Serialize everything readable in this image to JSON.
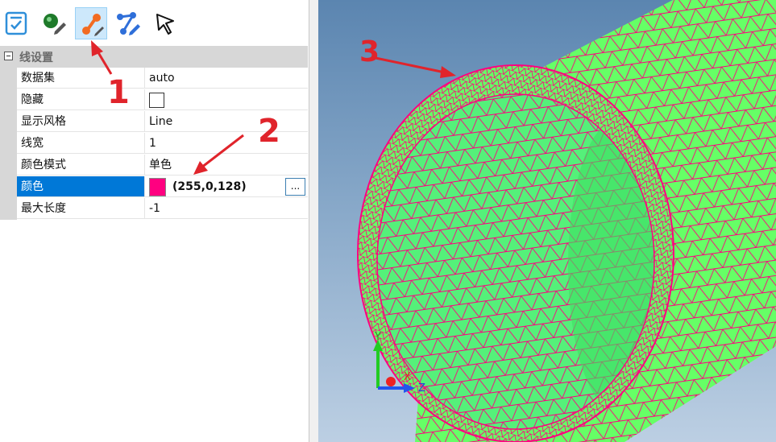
{
  "toolbar": {
    "buttons": [
      {
        "icon": "checklist-icon",
        "active": false
      },
      {
        "icon": "node-pen-icon",
        "active": false
      },
      {
        "icon": "line-edit-icon",
        "active": true
      },
      {
        "icon": "polyline-pen-icon",
        "active": false
      },
      {
        "icon": "cursor-arrow-icon",
        "active": false
      }
    ]
  },
  "property_grid": {
    "group_title": "线设置",
    "rows": [
      {
        "name": "数据集",
        "value": "auto"
      },
      {
        "name": "隐藏",
        "value": ""
      },
      {
        "name": "显示风格",
        "value": "Line"
      },
      {
        "name": "线宽",
        "value": "1"
      },
      {
        "name": "颜色模式",
        "value": "单色"
      },
      {
        "name": "颜色",
        "value": "(255,0,128)",
        "swatch": "#ff0080",
        "button": "..."
      },
      {
        "name": "最大长度",
        "value": "-1"
      }
    ]
  },
  "annotations": {
    "one": "1",
    "two": "2",
    "three": "3",
    "color": "#e0242b"
  },
  "viewport": {
    "background": "gradient-blue",
    "mesh_fill": "#66ff66",
    "mesh_line": "#ff0080",
    "axes": {
      "y": "Y",
      "x": "X",
      "z": "Z"
    }
  }
}
